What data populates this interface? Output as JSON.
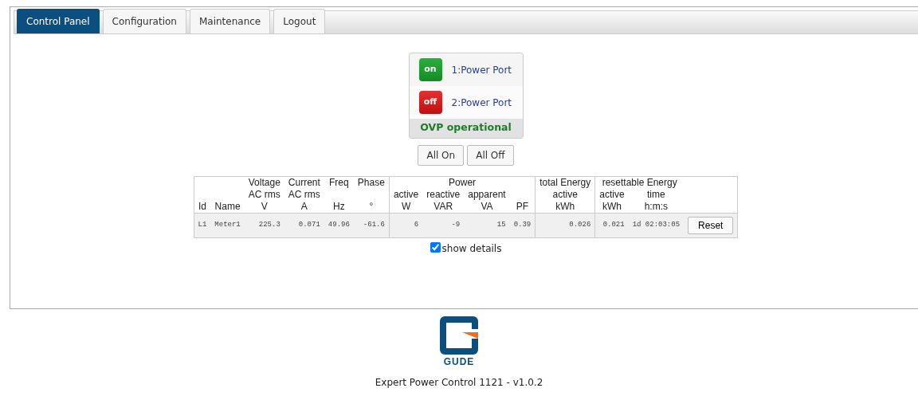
{
  "tabs": [
    {
      "label": "Control Panel",
      "selected": true
    },
    {
      "label": "Configuration",
      "selected": false
    },
    {
      "label": "Maintenance",
      "selected": false
    },
    {
      "label": "Logout",
      "selected": false
    }
  ],
  "ports": [
    {
      "state_label": "on",
      "on": true,
      "label": "1:Power Port"
    },
    {
      "state_label": "off",
      "on": false,
      "label": "2:Power Port"
    }
  ],
  "ovp_status": "OVP operational",
  "buttons": [
    "All On",
    "All Off"
  ],
  "meter_table": {
    "groups": [
      {
        "columns": [
          {
            "unit": "Id"
          },
          {
            "unit": "Name"
          },
          {
            "top": "Voltage",
            "middle": "AC rms",
            "unit": "V"
          },
          {
            "top": "Current",
            "middle": "AC rms",
            "unit": "A"
          },
          {
            "top": "Freq",
            "unit": "Hz"
          },
          {
            "top": "Phase",
            "unit": "°"
          }
        ]
      },
      {
        "title": "Power",
        "columns": [
          {
            "middle": "active",
            "unit": "W"
          },
          {
            "middle": "reactive",
            "unit": "VAR"
          },
          {
            "middle": "apparent",
            "unit": "VA"
          },
          {
            "unit": "PF"
          }
        ]
      },
      {
        "columns": [
          {
            "top": "total Energy",
            "middle": "active",
            "unit": "kWh"
          }
        ]
      },
      {
        "title": "resettable Energy",
        "columns": [
          {
            "middle": "active",
            "unit": "kWh"
          },
          {
            "middle": "time",
            "unit": "h:m:s"
          }
        ]
      }
    ],
    "rows": [
      {
        "cells": [
          "L1",
          "Meter1",
          "225.3",
          "0.071",
          "49.96",
          "-61.6",
          "6",
          "-9",
          "15",
          "0.39",
          "0.026",
          "0.021",
          "1d 02:03:05"
        ],
        "button": "Reset"
      }
    ]
  },
  "show_details": {
    "label": "show details",
    "checked": true
  },
  "footer": {
    "logo_text": "GUDE",
    "product": "Expert Power Control 1121 - v1.0.2"
  }
}
